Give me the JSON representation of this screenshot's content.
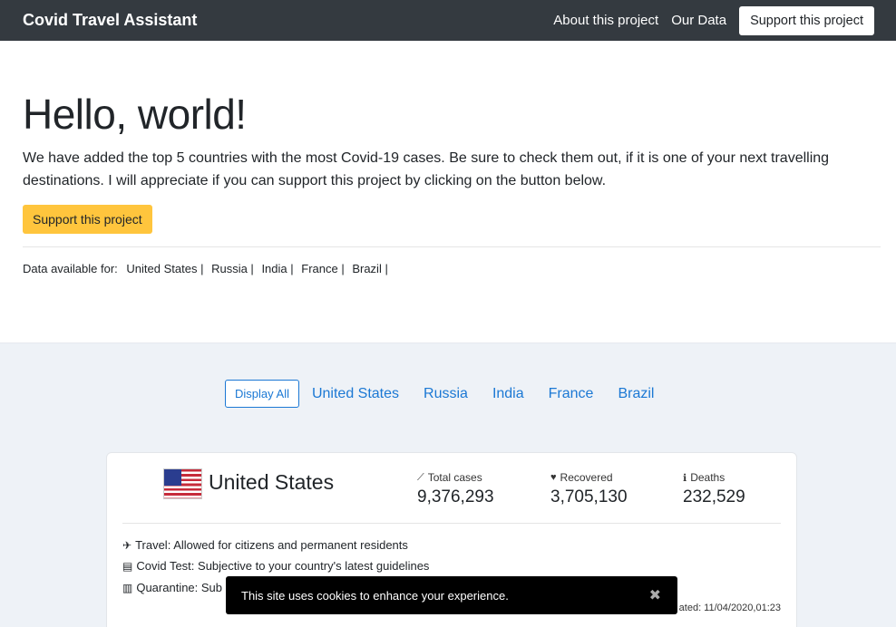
{
  "navbar": {
    "brand": "Covid Travel Assistant",
    "links": [
      "About this project",
      "Our Data"
    ],
    "support_button": "Support this project"
  },
  "hero": {
    "title": "Hello, world!",
    "lead": "We have added the top 5 countries with the most Covid-19 cases. Be sure to check them out, if it is one of your next travelling destinations. I will appreciate if you can support this project by clicking on the button below.",
    "support_button": "Support this project",
    "available_label": "Data available for:",
    "available_countries": [
      "United States |",
      "Russia |",
      "India |",
      "France |",
      "Brazil |"
    ]
  },
  "filters": {
    "active": "Display All",
    "countries": [
      "United States",
      "Russia",
      "India",
      "France",
      "Brazil"
    ]
  },
  "card": {
    "country": "United States",
    "flag_icon": "us-flag-icon",
    "stats": [
      {
        "icon": "chart-line-icon",
        "glyph": "⟋",
        "label": "Total cases",
        "value": "9,376,293"
      },
      {
        "icon": "heart-icon",
        "glyph": "♥",
        "label": "Recovered",
        "value": "3,705,130"
      },
      {
        "icon": "info-circle-icon",
        "glyph": "ℹ",
        "label": "Deaths",
        "value": "232,529"
      }
    ],
    "travel": "Travel: Allowed for citizens and permanent residents",
    "covid_test": "Covid Test: Subjective to your country's latest guidelines",
    "quarantine": "Quarantine: Sub",
    "updated": "ated: 11/04/2020,01:23"
  },
  "cookie": {
    "message": "This site uses cookies to enhance your experience.",
    "close": "✖"
  },
  "colors": {
    "navbar_bg": "#343a40",
    "accent_blue": "#1b78d4",
    "warning": "#ffc53d",
    "section_bg": "#eef2f7"
  }
}
